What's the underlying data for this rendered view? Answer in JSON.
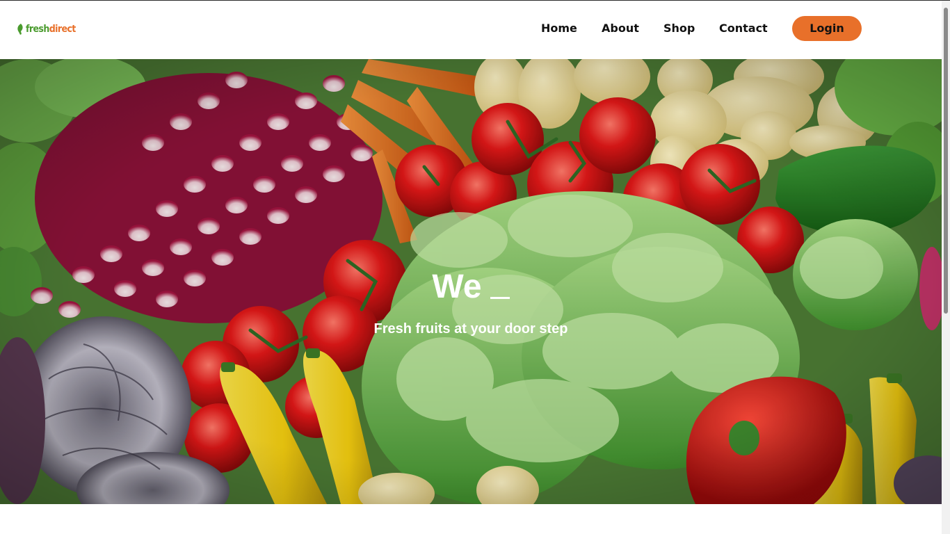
{
  "brand": {
    "logo_fresh": "fresh",
    "logo_direct": "direct",
    "color_green": "#4a9b2e",
    "color_orange": "#e8702a",
    "logo_icon": "leaf-icon"
  },
  "nav": {
    "items": [
      {
        "label": "Home"
      },
      {
        "label": "About"
      },
      {
        "label": "Shop"
      },
      {
        "label": "Contact"
      }
    ],
    "login_label": "Login",
    "login_color": "#e8702a"
  },
  "hero": {
    "title": "We",
    "subtitle": "Fresh fruits at your door step",
    "background": "vegetables-photo"
  }
}
